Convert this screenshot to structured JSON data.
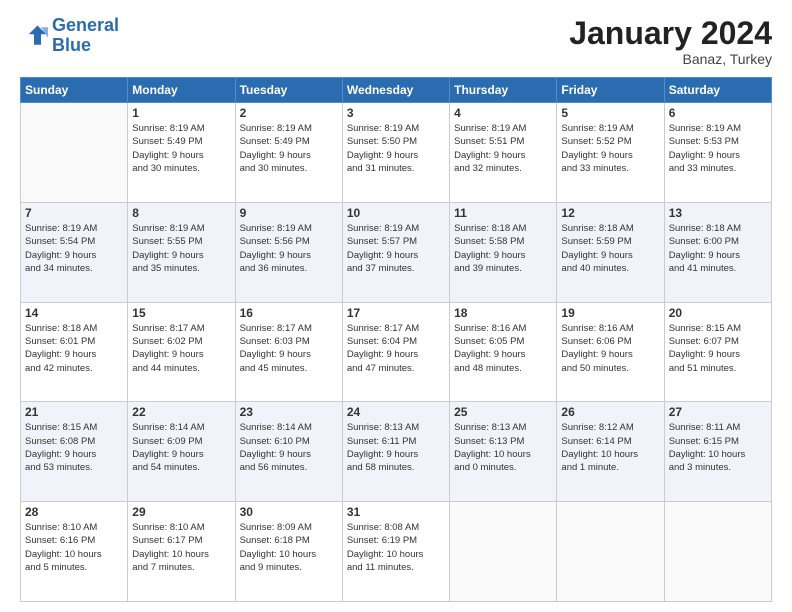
{
  "logo": {
    "line1": "General",
    "line2": "Blue"
  },
  "title": "January 2024",
  "subtitle": "Banaz, Turkey",
  "header_days": [
    "Sunday",
    "Monday",
    "Tuesday",
    "Wednesday",
    "Thursday",
    "Friday",
    "Saturday"
  ],
  "weeks": [
    {
      "shade": false,
      "days": [
        {
          "num": "",
          "info": ""
        },
        {
          "num": "1",
          "info": "Sunrise: 8:19 AM\nSunset: 5:49 PM\nDaylight: 9 hours\nand 30 minutes."
        },
        {
          "num": "2",
          "info": "Sunrise: 8:19 AM\nSunset: 5:49 PM\nDaylight: 9 hours\nand 30 minutes."
        },
        {
          "num": "3",
          "info": "Sunrise: 8:19 AM\nSunset: 5:50 PM\nDaylight: 9 hours\nand 31 minutes."
        },
        {
          "num": "4",
          "info": "Sunrise: 8:19 AM\nSunset: 5:51 PM\nDaylight: 9 hours\nand 32 minutes."
        },
        {
          "num": "5",
          "info": "Sunrise: 8:19 AM\nSunset: 5:52 PM\nDaylight: 9 hours\nand 33 minutes."
        },
        {
          "num": "6",
          "info": "Sunrise: 8:19 AM\nSunset: 5:53 PM\nDaylight: 9 hours\nand 33 minutes."
        }
      ]
    },
    {
      "shade": true,
      "days": [
        {
          "num": "7",
          "info": "Sunrise: 8:19 AM\nSunset: 5:54 PM\nDaylight: 9 hours\nand 34 minutes."
        },
        {
          "num": "8",
          "info": "Sunrise: 8:19 AM\nSunset: 5:55 PM\nDaylight: 9 hours\nand 35 minutes."
        },
        {
          "num": "9",
          "info": "Sunrise: 8:19 AM\nSunset: 5:56 PM\nDaylight: 9 hours\nand 36 minutes."
        },
        {
          "num": "10",
          "info": "Sunrise: 8:19 AM\nSunset: 5:57 PM\nDaylight: 9 hours\nand 37 minutes."
        },
        {
          "num": "11",
          "info": "Sunrise: 8:18 AM\nSunset: 5:58 PM\nDaylight: 9 hours\nand 39 minutes."
        },
        {
          "num": "12",
          "info": "Sunrise: 8:18 AM\nSunset: 5:59 PM\nDaylight: 9 hours\nand 40 minutes."
        },
        {
          "num": "13",
          "info": "Sunrise: 8:18 AM\nSunset: 6:00 PM\nDaylight: 9 hours\nand 41 minutes."
        }
      ]
    },
    {
      "shade": false,
      "days": [
        {
          "num": "14",
          "info": "Sunrise: 8:18 AM\nSunset: 6:01 PM\nDaylight: 9 hours\nand 42 minutes."
        },
        {
          "num": "15",
          "info": "Sunrise: 8:17 AM\nSunset: 6:02 PM\nDaylight: 9 hours\nand 44 minutes."
        },
        {
          "num": "16",
          "info": "Sunrise: 8:17 AM\nSunset: 6:03 PM\nDaylight: 9 hours\nand 45 minutes."
        },
        {
          "num": "17",
          "info": "Sunrise: 8:17 AM\nSunset: 6:04 PM\nDaylight: 9 hours\nand 47 minutes."
        },
        {
          "num": "18",
          "info": "Sunrise: 8:16 AM\nSunset: 6:05 PM\nDaylight: 9 hours\nand 48 minutes."
        },
        {
          "num": "19",
          "info": "Sunrise: 8:16 AM\nSunset: 6:06 PM\nDaylight: 9 hours\nand 50 minutes."
        },
        {
          "num": "20",
          "info": "Sunrise: 8:15 AM\nSunset: 6:07 PM\nDaylight: 9 hours\nand 51 minutes."
        }
      ]
    },
    {
      "shade": true,
      "days": [
        {
          "num": "21",
          "info": "Sunrise: 8:15 AM\nSunset: 6:08 PM\nDaylight: 9 hours\nand 53 minutes."
        },
        {
          "num": "22",
          "info": "Sunrise: 8:14 AM\nSunset: 6:09 PM\nDaylight: 9 hours\nand 54 minutes."
        },
        {
          "num": "23",
          "info": "Sunrise: 8:14 AM\nSunset: 6:10 PM\nDaylight: 9 hours\nand 56 minutes."
        },
        {
          "num": "24",
          "info": "Sunrise: 8:13 AM\nSunset: 6:11 PM\nDaylight: 9 hours\nand 58 minutes."
        },
        {
          "num": "25",
          "info": "Sunrise: 8:13 AM\nSunset: 6:13 PM\nDaylight: 10 hours\nand 0 minutes."
        },
        {
          "num": "26",
          "info": "Sunrise: 8:12 AM\nSunset: 6:14 PM\nDaylight: 10 hours\nand 1 minute."
        },
        {
          "num": "27",
          "info": "Sunrise: 8:11 AM\nSunset: 6:15 PM\nDaylight: 10 hours\nand 3 minutes."
        }
      ]
    },
    {
      "shade": false,
      "days": [
        {
          "num": "28",
          "info": "Sunrise: 8:10 AM\nSunset: 6:16 PM\nDaylight: 10 hours\nand 5 minutes."
        },
        {
          "num": "29",
          "info": "Sunrise: 8:10 AM\nSunset: 6:17 PM\nDaylight: 10 hours\nand 7 minutes."
        },
        {
          "num": "30",
          "info": "Sunrise: 8:09 AM\nSunset: 6:18 PM\nDaylight: 10 hours\nand 9 minutes."
        },
        {
          "num": "31",
          "info": "Sunrise: 8:08 AM\nSunset: 6:19 PM\nDaylight: 10 hours\nand 11 minutes."
        },
        {
          "num": "",
          "info": ""
        },
        {
          "num": "",
          "info": ""
        },
        {
          "num": "",
          "info": ""
        }
      ]
    }
  ]
}
